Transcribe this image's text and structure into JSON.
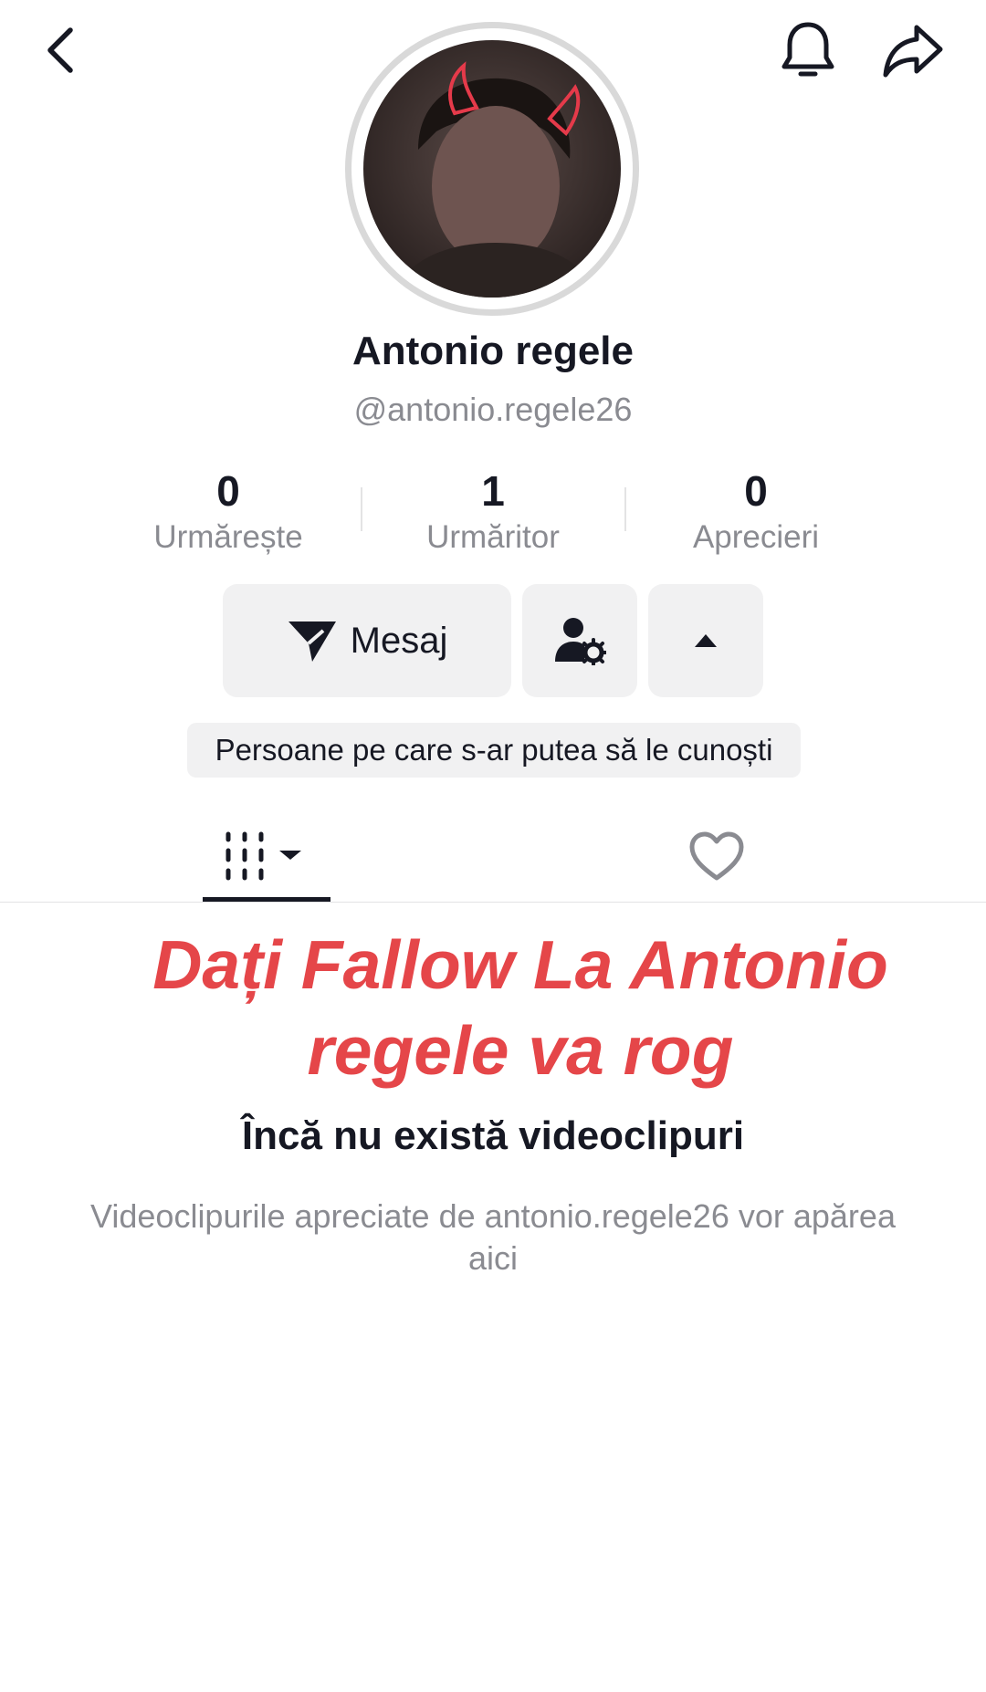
{
  "header": {
    "back_icon": "chevron-left-icon",
    "bell_icon": "bell-icon",
    "share_icon": "share-arrow-icon"
  },
  "profile": {
    "display_name": "Antonio regele",
    "handle": "@antonio.regele26"
  },
  "stats": [
    {
      "value": "0",
      "label": "Urmărește"
    },
    {
      "value": "1",
      "label": "Urmăritor"
    },
    {
      "value": "0",
      "label": "Aprecieri"
    }
  ],
  "actions": {
    "message_label": "Mesaj",
    "message_icon": "send-plane-icon",
    "user_settings_icon": "user-gear-icon",
    "collapse_icon": "caret-up-icon"
  },
  "suggestions_label": "Persoane pe care s-ar putea să le cunoști",
  "tabs": {
    "videos_icon": "grid-columns-icon",
    "liked_icon": "heart-icon"
  },
  "overlay_text": "Dați  Fallow La Antonio regele va rog",
  "empty_state": {
    "title": "Încă nu există videoclipuri",
    "description": "Videoclipurile apreciate de antonio.regele26 vor apărea aici"
  },
  "colors": {
    "text_primary": "#161823",
    "text_secondary": "#8a8b91",
    "button_bg": "#f1f1f2",
    "overlay_red": "#e54649",
    "avatar_ring": "#d9d9d9"
  }
}
